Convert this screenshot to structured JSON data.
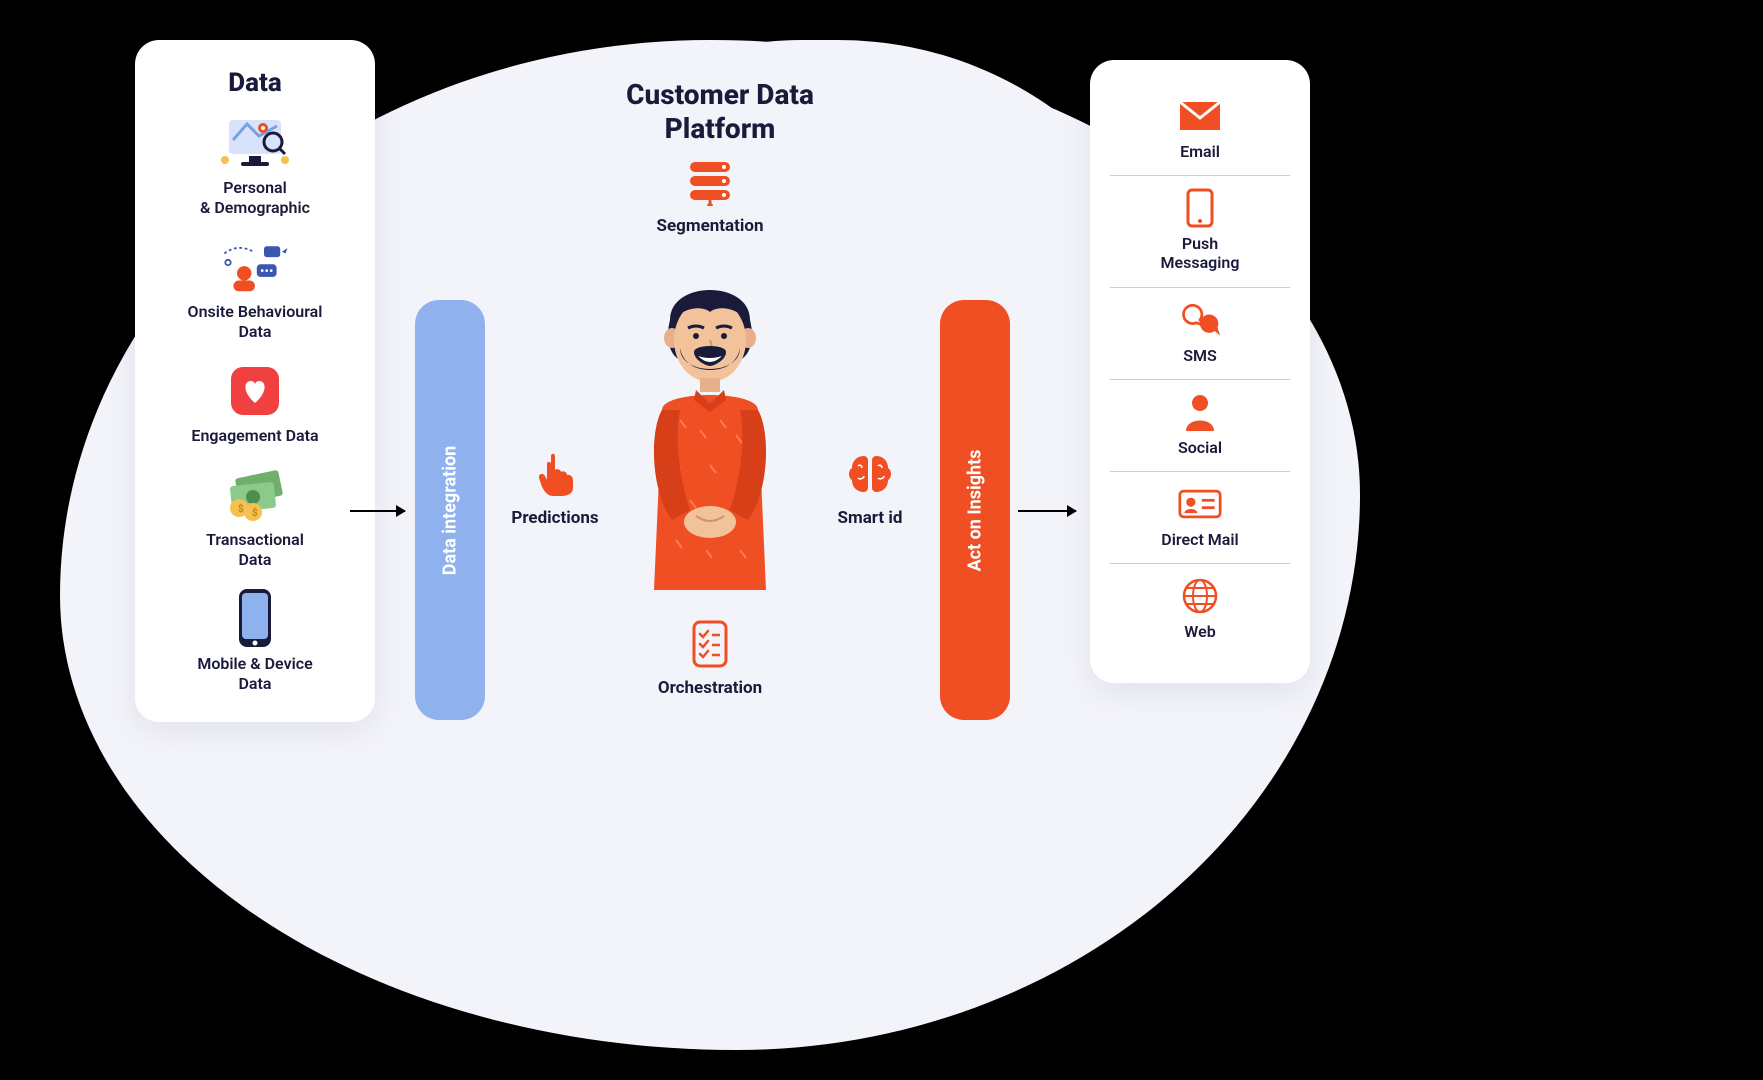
{
  "colors": {
    "accent": "#F04E23",
    "blue": "#8FB2EE",
    "panel": "#F3F4FA",
    "text": "#1A1B3A"
  },
  "data_card": {
    "title": "Data",
    "items": [
      {
        "label": "Personal\n& Demographic",
        "icon": "map-pin-monitor"
      },
      {
        "label": "Onsite Behavioural\nData",
        "icon": "chat-person"
      },
      {
        "label": "Engagement Data",
        "icon": "heart-app"
      },
      {
        "label": "Transactional\nData",
        "icon": "money"
      },
      {
        "label": "Mobile & Device\nData",
        "icon": "phone"
      }
    ]
  },
  "bars": {
    "integration": "Data integration",
    "insights": "Act on Insights"
  },
  "center": {
    "title": "Customer Data\nPlatform",
    "nodes": {
      "segmentation": "Segmentation",
      "predictions": "Predictions",
      "smart_id": "Smart id",
      "orchestration": "Orchestration"
    }
  },
  "channels": [
    {
      "label": "Email",
      "icon": "envelope"
    },
    {
      "label": "Push\nMessaging",
      "icon": "mobile"
    },
    {
      "label": "SMS",
      "icon": "chat-bubbles"
    },
    {
      "label": "Social",
      "icon": "person"
    },
    {
      "label": "Direct Mail",
      "icon": "id-card"
    },
    {
      "label": "Web",
      "icon": "globe"
    }
  ]
}
